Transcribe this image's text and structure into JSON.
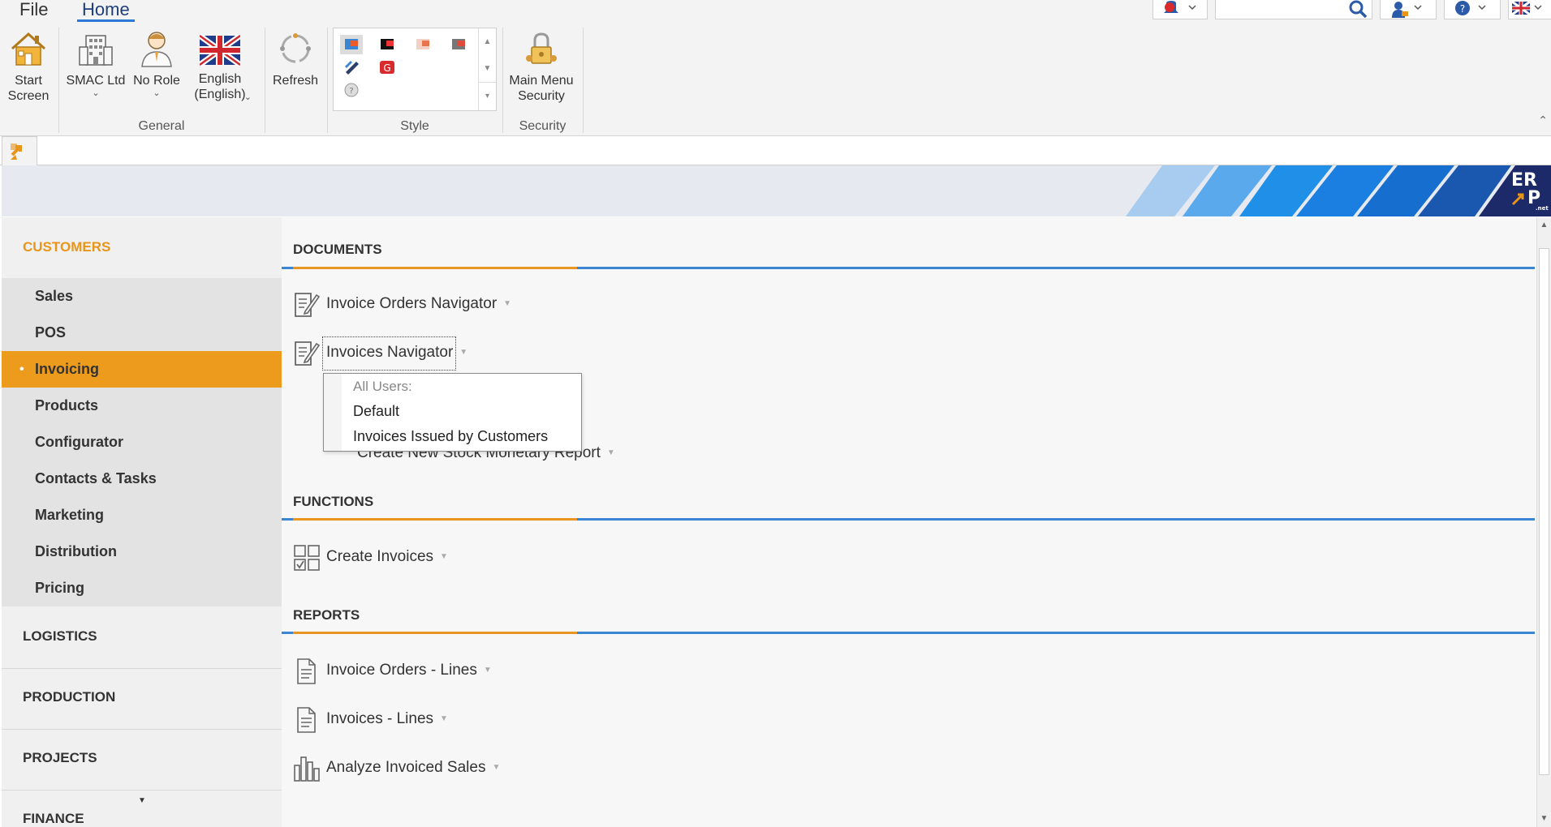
{
  "menu": {
    "file": "File",
    "home": "Home"
  },
  "ribbon": {
    "start_screen": "Start\nScreen",
    "company": "SMAC Ltd",
    "role": "No Role",
    "language": "English\n(English)",
    "refresh": "Refresh",
    "main_menu_security": "Main Menu\nSecurity",
    "groups": {
      "general": "General",
      "style": "Style",
      "security": "Security"
    },
    "search": {
      "value": "",
      "placeholder": ""
    }
  },
  "sidebar": {
    "sections": [
      {
        "label": "CUSTOMERS",
        "active": true
      },
      {
        "label": "LOGISTICS"
      },
      {
        "label": "PRODUCTION"
      },
      {
        "label": "PROJECTS"
      },
      {
        "label": "FINANCE"
      }
    ],
    "items": [
      "Sales",
      "POS",
      "Invoicing",
      "Products",
      "Configurator",
      "Contacts & Tasks",
      "Marketing",
      "Distribution",
      "Pricing"
    ],
    "active_item": "Invoicing"
  },
  "main": {
    "documents": {
      "title": "DOCUMENTS",
      "items": [
        "Invoice Orders Navigator",
        "Invoices Navigator",
        "Create New Stock Monetary Report"
      ]
    },
    "functions": {
      "title": "FUNCTIONS",
      "items": [
        "Create Invoices"
      ]
    },
    "reports": {
      "title": "REPORTS",
      "items": [
        "Invoice Orders - Lines",
        "Invoices - Lines",
        "Analyze Invoiced Sales"
      ]
    }
  },
  "popup": {
    "header": "All Users:",
    "items": [
      "Default",
      "Invoices Issued by Customers"
    ]
  },
  "logo": {
    "text_top": "ER",
    "text_bottom": "P",
    "sub": ".net"
  },
  "colors": {
    "accent_orange": "#ed9b1c",
    "accent_blue": "#3a86d4"
  }
}
